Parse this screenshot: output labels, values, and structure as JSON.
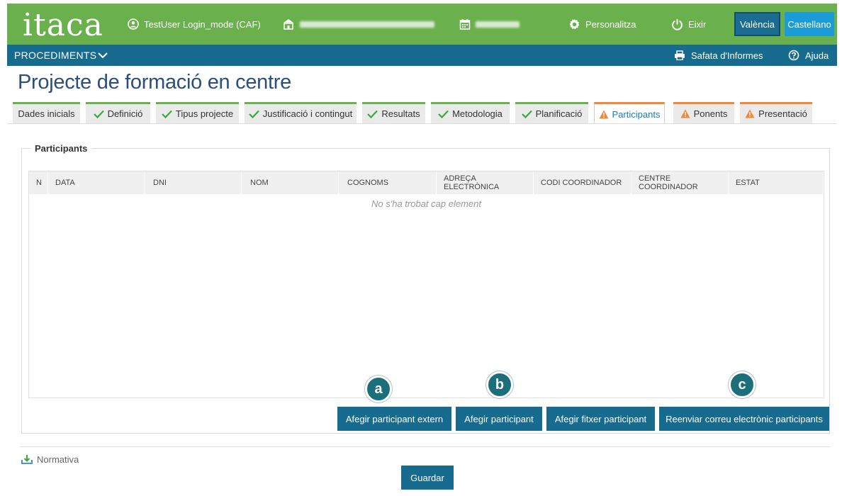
{
  "header": {
    "logo": "itaca",
    "user": "TestUser Login_mode (CAF)",
    "personalitza": "Personalitza",
    "eixir": "Eixir",
    "lang_valencia": "València",
    "lang_castellano": "Castellano"
  },
  "nav": {
    "procediments": "PROCEDIMENTS",
    "safata": "Safata d'Informes",
    "ajuda": "Ajuda"
  },
  "page": {
    "title": "Projecte de formació en centre"
  },
  "tabs": [
    {
      "label": "Dades inicials",
      "status": "none"
    },
    {
      "label": "Definició",
      "status": "ok"
    },
    {
      "label": "Tipus projecte",
      "status": "ok"
    },
    {
      "label": "Justificació i contingut",
      "status": "ok"
    },
    {
      "label": "Resultats",
      "status": "ok"
    },
    {
      "label": "Metodologia",
      "status": "ok"
    },
    {
      "label": "Planificació",
      "status": "ok"
    },
    {
      "label": "Participants",
      "status": "warn"
    },
    {
      "label": "Ponents",
      "status": "warn"
    },
    {
      "label": "Presentació",
      "status": "warn"
    }
  ],
  "participants": {
    "legend": "Participants",
    "columns": [
      "N",
      "DATA",
      "DNI",
      "NOM",
      "COGNOMS",
      "ADREÇA ELECTRÒNICA",
      "CODI COORDINADOR",
      "CENTRE COORDINADOR",
      "ESTAT"
    ],
    "empty_message": "No s'ha trobat cap element"
  },
  "buttons": {
    "add_external": "Afegir participant extern",
    "add": "Afegir participant",
    "add_file": "Afegir fitxer participant",
    "resend_email": "Reenviar correu electrònic participants",
    "save": "Guardar"
  },
  "markers": {
    "a": "a",
    "b": "b",
    "c": "c"
  },
  "footer": {
    "normativa": "Normativa"
  },
  "colors": {
    "header_green": "#6ab04c",
    "nav_blue": "#166b8e",
    "ok_check": "#3aa83a",
    "warn_orange": "#f0883a",
    "marker_teal": "#1b6e7a"
  }
}
